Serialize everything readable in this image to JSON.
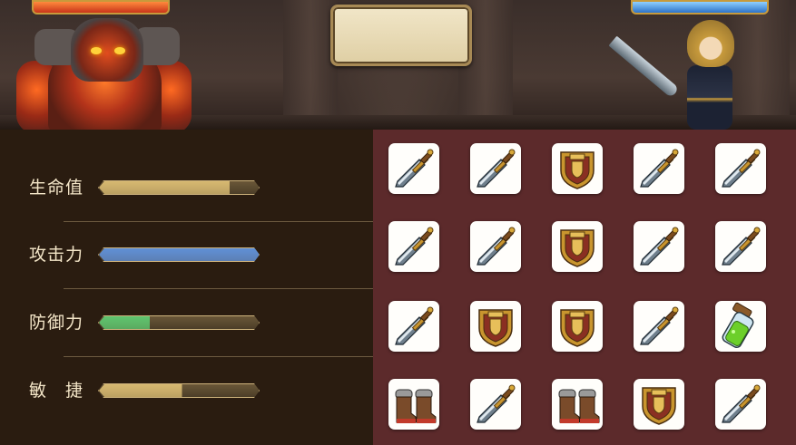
{
  "stats": [
    {
      "label": "生命值",
      "value": 0.82,
      "color": "#d6b870"
    },
    {
      "label": "攻击力",
      "value": 1.0,
      "color": "#5f8fd6"
    },
    {
      "label": "防御力",
      "value": 0.32,
      "color": "#5ec46e"
    },
    {
      "label": "敏　捷",
      "value": 0.52,
      "color": "#d6b870"
    }
  ],
  "inventory": {
    "rows": [
      [
        "sword-icon",
        "sword-icon",
        "shield-icon",
        "sword-icon",
        "sword-icon"
      ],
      [
        "sword-icon",
        "sword-icon",
        "shield-icon",
        "sword-icon",
        "sword-icon"
      ],
      [
        "sword-icon",
        "shield-icon",
        "shield-icon",
        "sword-icon",
        "potion-icon"
      ],
      [
        "boots-icon",
        "sword-icon",
        "boots-icon",
        "shield-icon",
        "sword-icon"
      ]
    ]
  },
  "battle": {
    "enemy": "lava-golem",
    "player": "armored-knight",
    "enemy_bar_color": "#e0531f",
    "player_bar_color": "#4a90d9"
  }
}
